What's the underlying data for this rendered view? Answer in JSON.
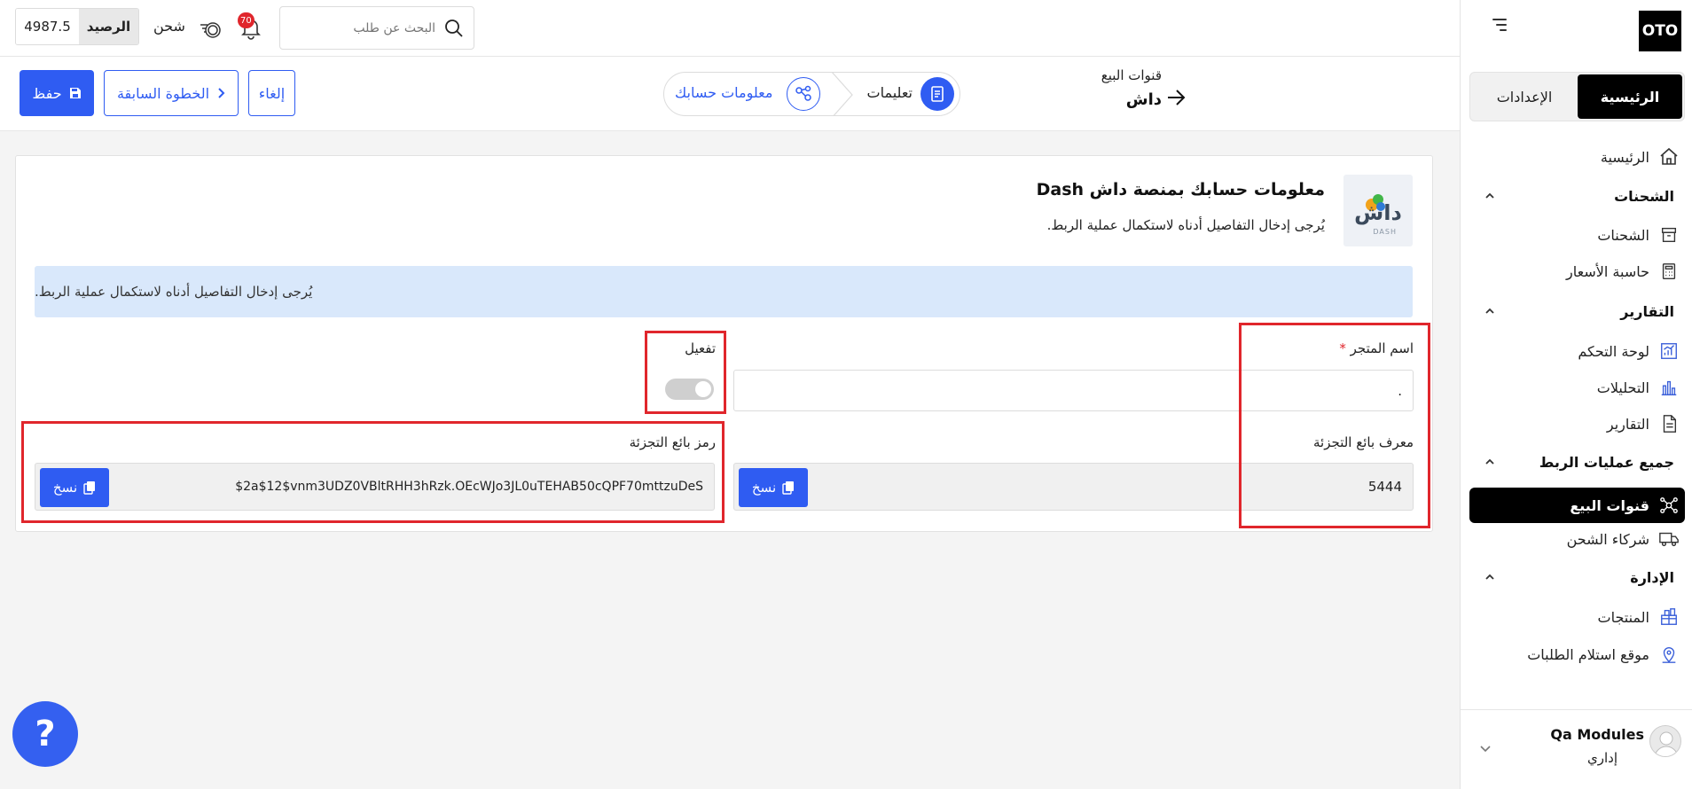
{
  "sidebar": {
    "logo": "OTO",
    "tabs": {
      "main": "الرئيسية",
      "settings": "الإعدادات"
    },
    "home_item": "الرئيسية",
    "shipments_section": "الشحنات",
    "shipments_item": "الشحنات",
    "price_calc_item": "حاسبة الأسعار",
    "reports_section": "التقارير",
    "dashboard_item": "لوحة التحكم",
    "analytics_item": "التحليلات",
    "reports_item": "التقارير",
    "integrations_section": "جميع عمليات الربط",
    "sales_channels_item": "قنوات البيع",
    "shipping_partners_item": "شركاء الشحن",
    "management_section": "الإدارة",
    "products_item": "المنتجات",
    "pickup_location_item": "موقع استلام الطلبات",
    "user": {
      "name": "Qa Modules",
      "role": "إداري"
    }
  },
  "topbar": {
    "search_placeholder": "البحث عن طلب",
    "notification_count": "70",
    "shipping_label": "شحن",
    "balance_label": "الرصيد",
    "balance_value": "4987.5"
  },
  "breadcrumb": {
    "parent": "قنوات البيع",
    "title": "داش"
  },
  "steps": {
    "step1": "تعليمات",
    "step2": "معلومات حسابك"
  },
  "actions": {
    "save": "حفظ",
    "previous": "الخطوة السابقة",
    "cancel": "إلغاء"
  },
  "card": {
    "logo_text": "داش",
    "logo_sub": "DASH",
    "title": "معلومات حسابك بمنصة داش Dash",
    "subtitle": "يُرجى إدخال التفاصيل أدناه لاستكمال عملية الربط.",
    "info_banner": "يُرجى إدخال التفاصيل أدناه لاستكمال عملية الربط.",
    "store_name_label": "اسم المتجر",
    "required_mark": "*",
    "store_name_value": ".",
    "activation_label": "تفعيل",
    "merchant_id_label": "معرف بائع التجزئة",
    "merchant_id_value": "5444",
    "merchant_token_label": "رمز بائع التجزئة",
    "merchant_token_value": "$2a$12$vnm3UDZ0VBltRHH3hRzk.OEcWJo3JL0uTEHAB50cQPF70mttzuDeS",
    "copy_label": "نسخ"
  },
  "help": {
    "label": "?"
  },
  "colors": {
    "primary": "#2f5cf2",
    "highlight": "#e0262c",
    "info_bg": "#d9e8fb",
    "active_nav": "#000000"
  }
}
